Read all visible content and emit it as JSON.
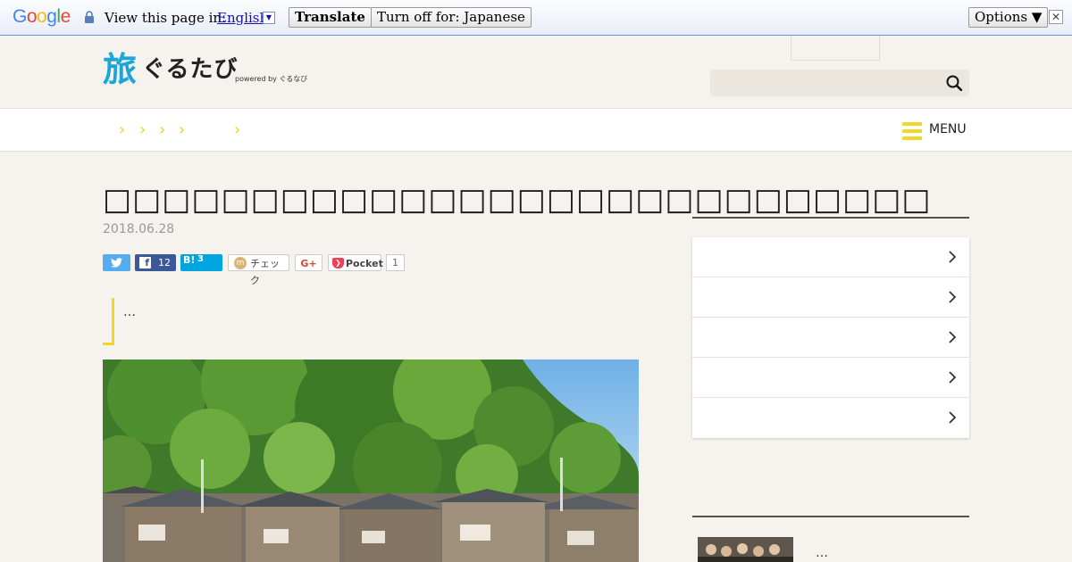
{
  "translate_bar": {
    "logo": "Google",
    "prompt": "View this page in:",
    "language": "English",
    "dropdown_glyph": "▼",
    "translate_label": "Translate",
    "turn_off_label": "Turn off for: Japanese",
    "options_label": "Options ▼",
    "close_glyph": "✕"
  },
  "header": {
    "logo_mark": "旅",
    "logo_text": "ぐるたび",
    "logo_sub": "powered by ぐるなび",
    "search": {
      "placeholder": "",
      "icon": "search-icon"
    }
  },
  "nav": {
    "crumb_glyph": "›",
    "menu_label": "MENU",
    "menu_icon": "hamburger-icon"
  },
  "article": {
    "title": "□□□□□□□□□□□□□□□□□□□□□□□□□□□□",
    "date": "2018.06.28",
    "lead": "…",
    "share": {
      "twitter_icon": "twitter-icon",
      "facebook_count": "12",
      "hatena_label": "B!",
      "hatena_count": "3",
      "mixi_label": "チェック",
      "gplus_label": "G+",
      "pocket_label": "Pocket",
      "pocket_count": "1"
    }
  },
  "sidebar": {
    "items": [
      {
        "label": ""
      },
      {
        "label": ""
      },
      {
        "label": ""
      },
      {
        "label": ""
      },
      {
        "label": ""
      }
    ],
    "bottom_text": "…"
  },
  "colors": {
    "accent_yellow": "#f3d728",
    "background": "#f6f3ee",
    "twitter": "#55acee",
    "facebook": "#3b5998",
    "hatena": "#00a4de"
  }
}
